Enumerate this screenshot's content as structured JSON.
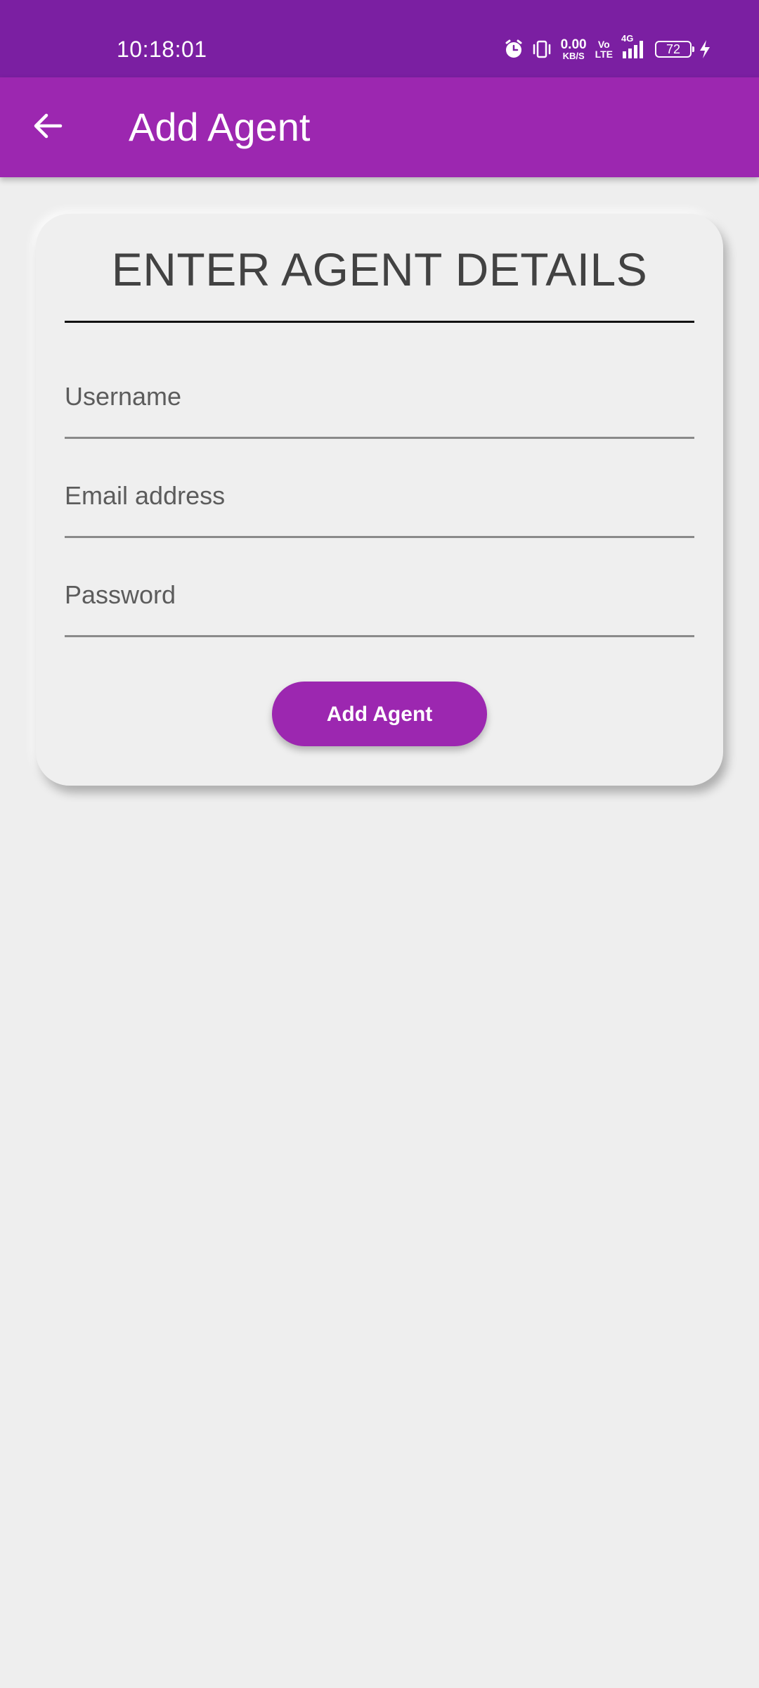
{
  "status_bar": {
    "time": "10:18:01",
    "net_speed_value": "0.00",
    "net_speed_unit": "KB/S",
    "volte_top": "Vo",
    "volte_bottom": "LTE",
    "network_type": "4G",
    "battery_level": "72",
    "icons": [
      "alarm-icon",
      "vibrate-icon",
      "signal-icon",
      "battery-icon",
      "charging-icon"
    ]
  },
  "app_bar": {
    "back_icon": "arrow-left-icon",
    "title": "Add Agent"
  },
  "form": {
    "heading": "ENTER AGENT DETAILS",
    "username": {
      "placeholder": "Username",
      "value": ""
    },
    "email": {
      "placeholder": "Email address",
      "value": ""
    },
    "password": {
      "placeholder": "Password",
      "value": ""
    },
    "submit_label": "Add Agent"
  },
  "colors": {
    "status_bar": "#7b1fa2",
    "primary": "#9c27b0",
    "background": "#eeeeee",
    "heading_text": "#424242"
  }
}
